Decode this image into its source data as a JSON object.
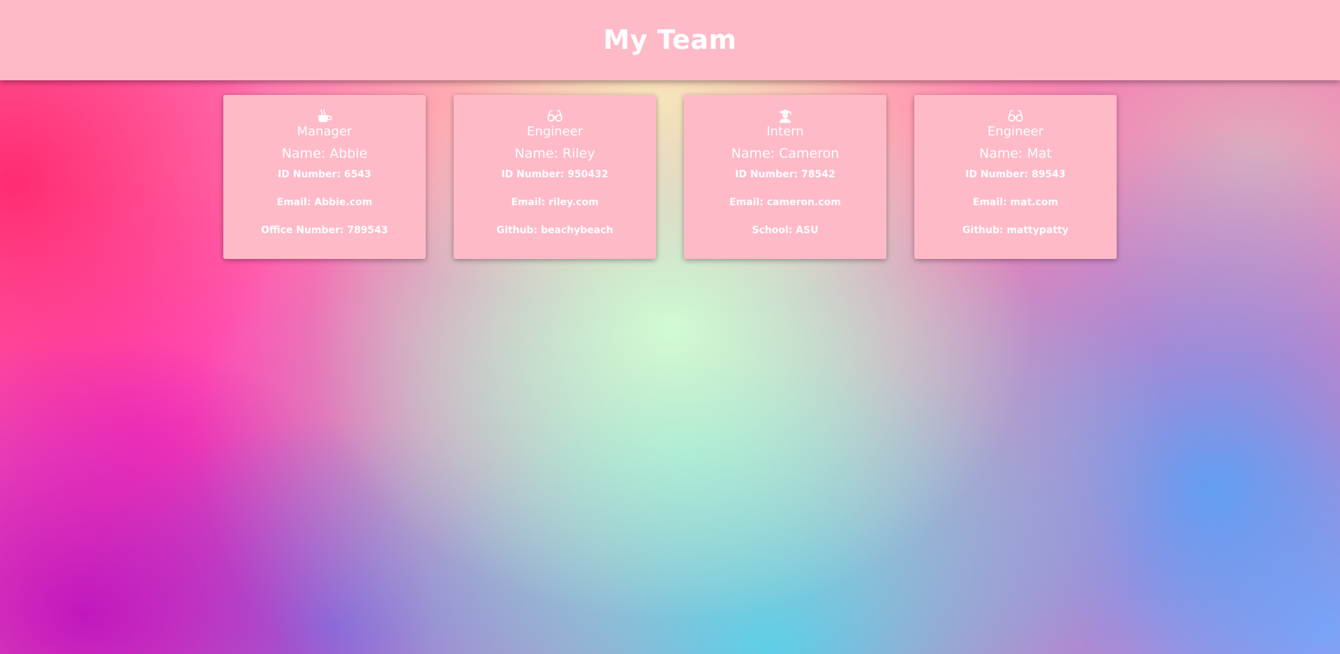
{
  "page": {
    "title": "My Team"
  },
  "team": [
    {
      "icon": "coffee-icon",
      "role": "Manager",
      "name": "Name: Abbie",
      "id": "ID Number: 6543",
      "email": "Email: Abbie.com",
      "extra": "Office Number: 789543"
    },
    {
      "icon": "glasses-icon",
      "role": "Engineer",
      "name": "Name: Riley",
      "id": "ID Number: 950432",
      "email": "Email: riley.com",
      "extra": "Github: beachybeach"
    },
    {
      "icon": "graduate-icon",
      "role": "Intern",
      "name": "Name: Cameron",
      "id": "ID Number: 78542",
      "email": "Email: cameron.com",
      "extra": "School: ASU"
    },
    {
      "icon": "glasses-icon",
      "role": "Engineer",
      "name": "Name: Mat",
      "id": "ID Number: 89543",
      "email": "Email: mat.com",
      "extra": "Github: mattypatty"
    }
  ],
  "colors": {
    "header_bg": "#ffbac8",
    "card_bg": "#ffbac8",
    "text": "#ffffff"
  }
}
